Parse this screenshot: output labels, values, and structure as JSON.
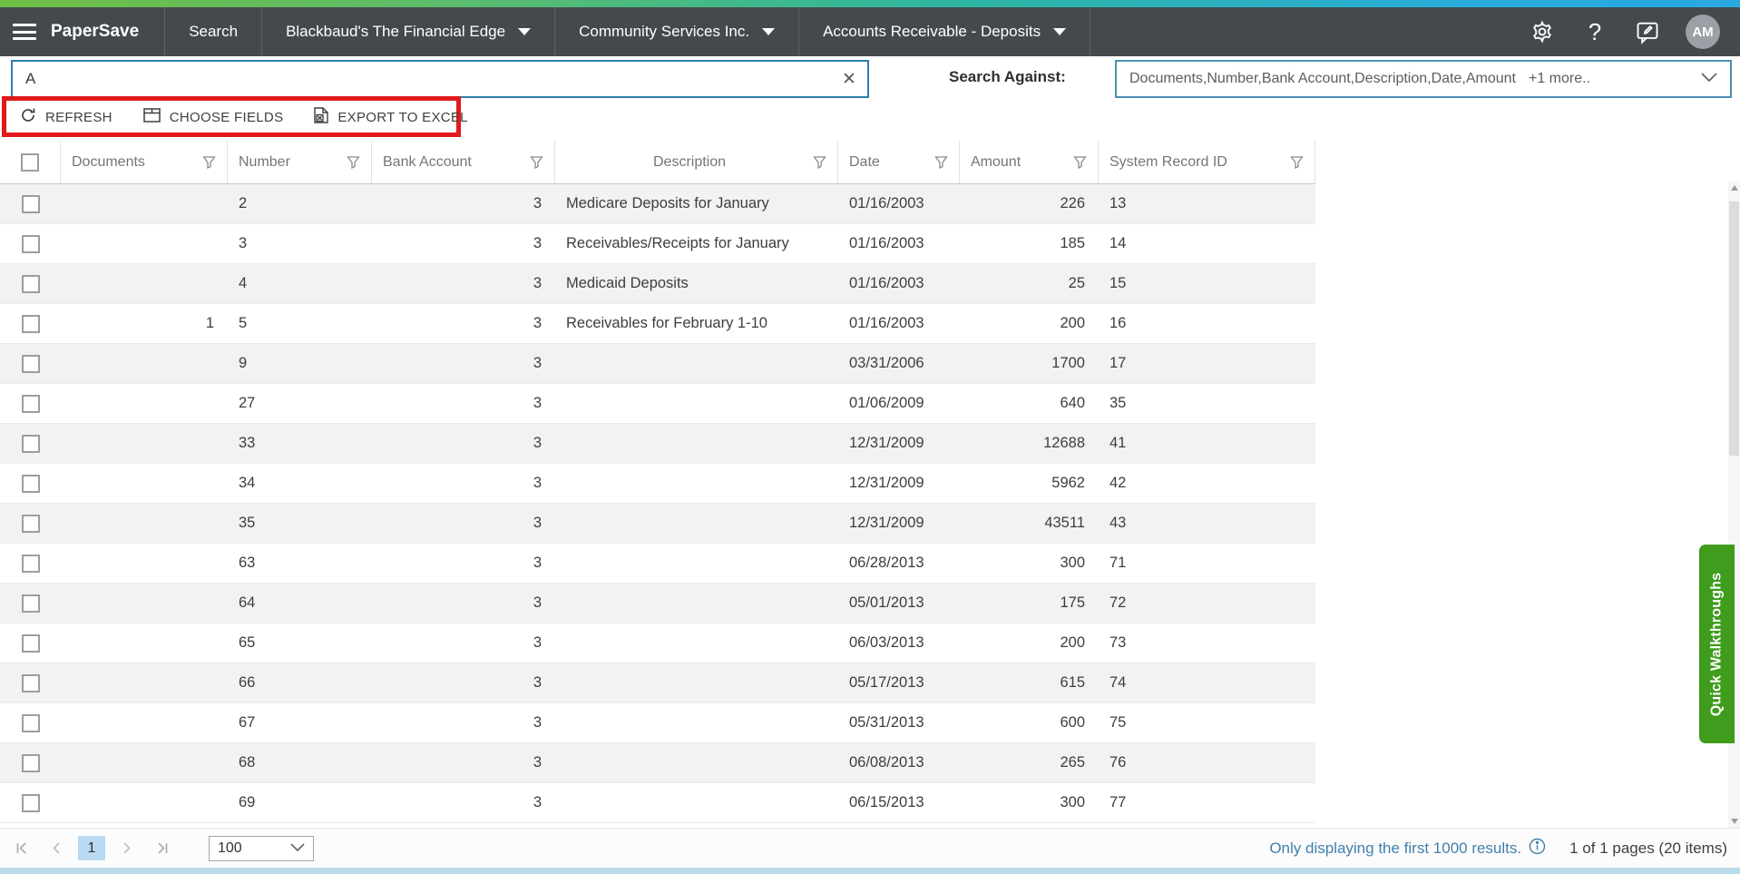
{
  "navbar": {
    "brand": "PaperSave",
    "items": [
      {
        "label": "Search",
        "has_caret": false
      },
      {
        "label": "Blackbaud's The Financial Edge",
        "has_caret": true
      },
      {
        "label": "Community Services Inc.",
        "has_caret": true
      },
      {
        "label": "Accounts Receivable - Deposits",
        "has_caret": true
      }
    ],
    "help_label": "?",
    "avatar_initials": "AM"
  },
  "search": {
    "value": "A",
    "clear_label": "✕",
    "against_label": "Search Against:",
    "against_value": "Documents,Number,Bank Account,Description,Date,Amount",
    "against_more": "+1 more.."
  },
  "toolbar": {
    "refresh_label": "REFRESH",
    "choose_fields_label": "CHOOSE FIELDS",
    "export_label": "EXPORT TO EXCEL"
  },
  "grid": {
    "columns": [
      "Documents",
      "Number",
      "Bank Account",
      "Description",
      "Date",
      "Amount",
      "System Record ID"
    ],
    "rows": [
      {
        "documents": "",
        "number": "2",
        "bank_account": "3",
        "description": "Medicare Deposits for January",
        "date": "01/16/2003",
        "amount": "226",
        "system_record_id": "13"
      },
      {
        "documents": "",
        "number": "3",
        "bank_account": "3",
        "description": "Receivables/Receipts for January",
        "date": "01/16/2003",
        "amount": "185",
        "system_record_id": "14"
      },
      {
        "documents": "",
        "number": "4",
        "bank_account": "3",
        "description": "Medicaid Deposits",
        "date": "01/16/2003",
        "amount": "25",
        "system_record_id": "15"
      },
      {
        "documents": "1",
        "number": "5",
        "bank_account": "3",
        "description": "Receivables for February 1-10",
        "date": "01/16/2003",
        "amount": "200",
        "system_record_id": "16"
      },
      {
        "documents": "",
        "number": "9",
        "bank_account": "3",
        "description": "",
        "date": "03/31/2006",
        "amount": "1700",
        "system_record_id": "17"
      },
      {
        "documents": "",
        "number": "27",
        "bank_account": "3",
        "description": "",
        "date": "01/06/2009",
        "amount": "640",
        "system_record_id": "35"
      },
      {
        "documents": "",
        "number": "33",
        "bank_account": "3",
        "description": "",
        "date": "12/31/2009",
        "amount": "12688",
        "system_record_id": "41"
      },
      {
        "documents": "",
        "number": "34",
        "bank_account": "3",
        "description": "",
        "date": "12/31/2009",
        "amount": "5962",
        "system_record_id": "42"
      },
      {
        "documents": "",
        "number": "35",
        "bank_account": "3",
        "description": "",
        "date": "12/31/2009",
        "amount": "43511",
        "system_record_id": "43"
      },
      {
        "documents": "",
        "number": "63",
        "bank_account": "3",
        "description": "",
        "date": "06/28/2013",
        "amount": "300",
        "system_record_id": "71"
      },
      {
        "documents": "",
        "number": "64",
        "bank_account": "3",
        "description": "",
        "date": "05/01/2013",
        "amount": "175",
        "system_record_id": "72"
      },
      {
        "documents": "",
        "number": "65",
        "bank_account": "3",
        "description": "",
        "date": "06/03/2013",
        "amount": "200",
        "system_record_id": "73"
      },
      {
        "documents": "",
        "number": "66",
        "bank_account": "3",
        "description": "",
        "date": "05/17/2013",
        "amount": "615",
        "system_record_id": "74"
      },
      {
        "documents": "",
        "number": "67",
        "bank_account": "3",
        "description": "",
        "date": "05/31/2013",
        "amount": "600",
        "system_record_id": "75"
      },
      {
        "documents": "",
        "number": "68",
        "bank_account": "3",
        "description": "",
        "date": "06/08/2013",
        "amount": "265",
        "system_record_id": "76"
      },
      {
        "documents": "",
        "number": "69",
        "bank_account": "3",
        "description": "",
        "date": "06/15/2013",
        "amount": "300",
        "system_record_id": "77"
      }
    ]
  },
  "footer": {
    "current_page": "1",
    "page_size": "100",
    "notice": "Only displaying the first 1000 results.",
    "summary": "1 of 1 pages (20 items)"
  },
  "walkthrough": {
    "label": "Quick Walkthroughs"
  },
  "colors": {
    "accent_green": "#6fbe45",
    "accent_teal": "#2eb6a2",
    "accent_blue": "#29a9e0",
    "navbar_bg": "#45494e",
    "annotation_red": "#e01a1a",
    "focus_border_blue": "#2b7fae",
    "link_blue": "#4180ad",
    "walkthrough_green": "#3f9c1c",
    "row_alt_gray": "#f2f2f2",
    "active_page_bg": "#b9daf4"
  }
}
